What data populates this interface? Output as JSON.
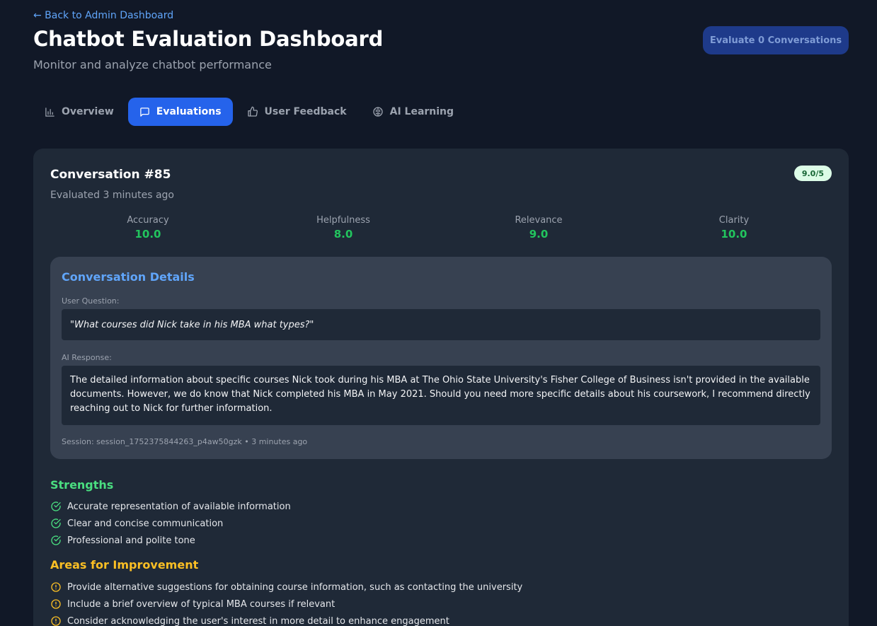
{
  "header": {
    "back_link": "← Back to Admin Dashboard",
    "title": "Chatbot Evaluation Dashboard",
    "subtitle": "Monitor and analyze chatbot performance",
    "evaluate_button": "Evaluate 0 Conversations"
  },
  "tabs": [
    {
      "label": "Overview",
      "icon": "bar-chart-icon",
      "active": false
    },
    {
      "label": "Evaluations",
      "icon": "message-square-icon",
      "active": true
    },
    {
      "label": "User Feedback",
      "icon": "thumbs-up-icon",
      "active": false
    },
    {
      "label": "AI Learning",
      "icon": "brain-icon",
      "active": false
    }
  ],
  "evaluation": {
    "title": "Conversation #85",
    "score_badge": "9.0/5",
    "evaluated": "Evaluated 3 minutes ago",
    "metrics": [
      {
        "label": "Accuracy",
        "value": "10.0"
      },
      {
        "label": "Helpfulness",
        "value": "8.0"
      },
      {
        "label": "Relevance",
        "value": "9.0"
      },
      {
        "label": "Clarity",
        "value": "10.0"
      }
    ],
    "details": {
      "title": "Conversation Details",
      "question_label": "User Question:",
      "question": "\"What courses did Nick take in his MBA what types?\"",
      "response_label": "AI Response:",
      "response": "The detailed information about specific courses Nick took during his MBA at The Ohio State University's Fisher College of Business isn't provided in the available documents. However, we do know that Nick completed his MBA in May 2021. Should you need more specific details about his coursework, I recommend directly reaching out to Nick for further information.",
      "session": "Session: session_1752375844263_p4aw50gzk • 3 minutes ago"
    },
    "strengths_title": "Strengths",
    "strengths": [
      "Accurate representation of available information",
      "Clear and concise communication",
      "Professional and polite tone"
    ],
    "improvements_title": "Areas for Improvement",
    "improvements": [
      "Provide alternative suggestions for obtaining course information, such as contacting the university",
      "Include a brief overview of typical MBA courses if relevant",
      "Consider acknowledging the user's interest in more detail to enhance engagement"
    ]
  },
  "colors": {
    "background": "#111827",
    "card": "#1f2937",
    "accent": "#2563eb",
    "success": "#22c55e",
    "warning": "#fbbf24",
    "link": "#60a5fa"
  }
}
